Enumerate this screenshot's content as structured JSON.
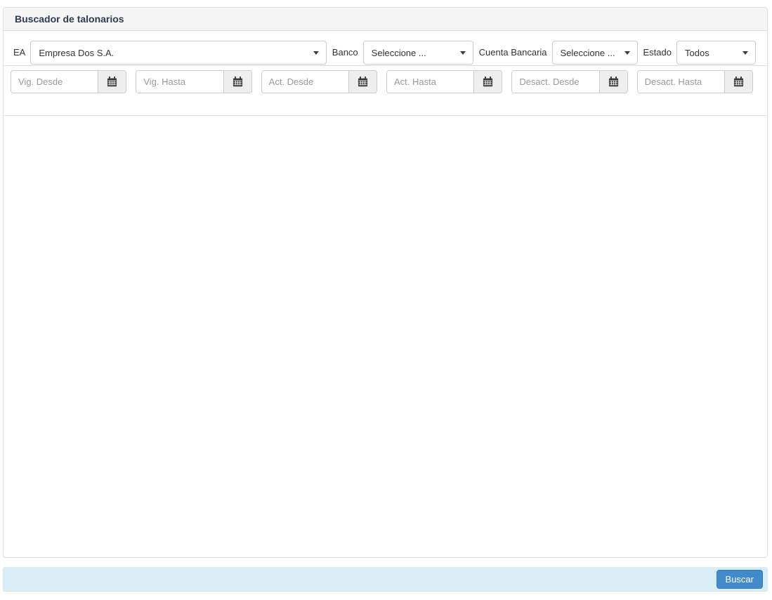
{
  "panel": {
    "title": "Buscador de talonarios"
  },
  "filters": {
    "ea": {
      "label": "EA",
      "value": "Empresa Dos S.A."
    },
    "banco": {
      "label": "Banco",
      "value": "Seleccione ..."
    },
    "cuenta_bancaria": {
      "label": "Cuenta Bancaria",
      "value": "Seleccione ..."
    },
    "estado": {
      "label": "Estado",
      "value": "Todos"
    }
  },
  "date_filters": [
    {
      "placeholder": "Vig. Desde",
      "value": ""
    },
    {
      "placeholder": "Vig. Hasta",
      "value": ""
    },
    {
      "placeholder": "Act. Desde",
      "value": ""
    },
    {
      "placeholder": "Act. Hasta",
      "value": ""
    },
    {
      "placeholder": "Desact. Desde",
      "value": ""
    },
    {
      "placeholder": "Desact. Hasta",
      "value": ""
    }
  ],
  "footer": {
    "search_button": "Buscar"
  },
  "icons": {
    "calendar": "calendar-icon",
    "select_caret": "chevron-down-icon"
  },
  "colors": {
    "accent": "#428bca",
    "accent-border": "#357ebd",
    "footer-bg": "#d9edf7",
    "heading-bg": "#f5f5f5",
    "border": "#dddddd",
    "heading-text": "#2e3d4e",
    "input-border": "#cccccc",
    "addon-bg": "#eeeeee",
    "icon": "#3a3a3a",
    "placeholder": "#999999",
    "text": "#333333"
  }
}
